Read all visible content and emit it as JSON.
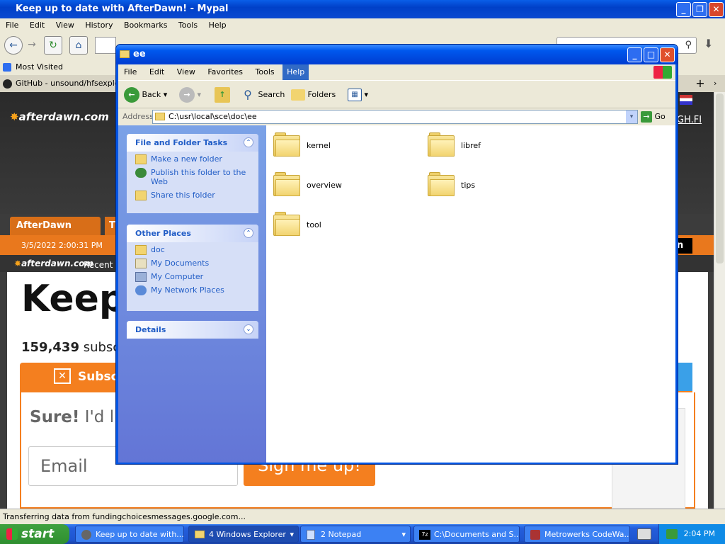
{
  "browser": {
    "title": "Keep up to date with AfterDawn! - Mypal",
    "menu": [
      "File",
      "Edit",
      "View",
      "History",
      "Bookmarks",
      "Tools",
      "Help"
    ],
    "bookmarks_label": "Most Visited",
    "tab_label": "GitHub - unsound/hfsexplorer",
    "status": "Transferring data from fundingchoicesmessages.google.com..."
  },
  "page": {
    "logo": "afterdawn.com",
    "nav_home": "AfterDawn Home",
    "nav_partial": "T",
    "datetime": "3/5/2022 2:00:31 PM",
    "recent_logo": "afterdawn.com",
    "recent": "Recent",
    "headline": "Keep",
    "subscribers": "159,439",
    "subs_suffix": "subsc",
    "subscribe": "Subscr",
    "sure": "Sure!",
    "sure_rest": "I'd lik",
    "email_placeholder": "Email",
    "sign_btn": "Sign me up!",
    "right_link": "GH.FI",
    "right_btn": "wn"
  },
  "explorer": {
    "title": "ee",
    "menu": [
      "File",
      "Edit",
      "View",
      "Favorites",
      "Tools",
      "Help"
    ],
    "toolbar": {
      "back": "Back",
      "search": "Search",
      "folders": "Folders"
    },
    "address_label": "Address",
    "address": "C:\\usr\\local\\sce\\doc\\ee",
    "go": "Go",
    "tasks_title": "File and Folder Tasks",
    "tasks": [
      "Make a new folder",
      "Publish this folder to the Web",
      "Share this folder"
    ],
    "places_title": "Other Places",
    "places": [
      "doc",
      "My Documents",
      "My Computer",
      "My Network Places"
    ],
    "details_title": "Details",
    "folders": [
      "kernel",
      "libref",
      "overview",
      "tips",
      "tool"
    ]
  },
  "taskbar": {
    "start": "start",
    "items": [
      "Keep up to date with...",
      "4 Windows Explorer",
      "2 Notepad",
      "C:\\Documents and S...",
      "Metrowerks CodeWa..."
    ],
    "clock": "2:04 PM"
  }
}
